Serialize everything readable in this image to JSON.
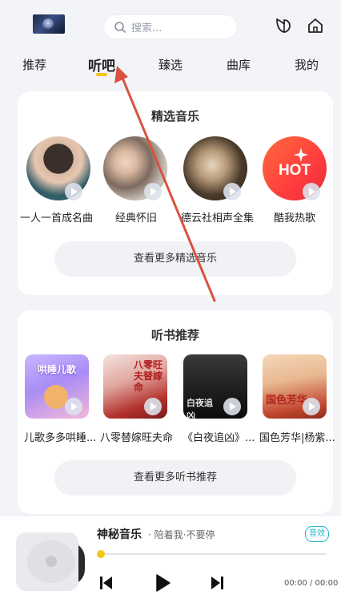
{
  "header": {
    "search_placeholder": "搜索...",
    "icons": [
      "profile-avatar",
      "search-icon",
      "leaf-icon",
      "home-icon"
    ]
  },
  "tabs": [
    {
      "label": "推荐",
      "active": false
    },
    {
      "label": "听吧",
      "active": true
    },
    {
      "label": "臻选",
      "active": false
    },
    {
      "label": "曲库",
      "active": false
    },
    {
      "label": "我的",
      "active": false
    }
  ],
  "featured_music": {
    "title": "精选音乐",
    "items": [
      {
        "label": "一人一首成名曲"
      },
      {
        "label": "经典怀旧"
      },
      {
        "label": "德云社相声全集"
      },
      {
        "label": "酷我热歌",
        "thumb_text": "HOT"
      }
    ],
    "more_label": "查看更多精选音乐"
  },
  "audiobooks": {
    "title": "听书推荐",
    "items": [
      {
        "label": "儿歌多多哄睡...",
        "thumb_text": "哄睡儿歌"
      },
      {
        "label": "八零替嫁旺夫命",
        "thumb_text": "八零旺夫替嫁命"
      },
      {
        "label": "《白夜追凶》...",
        "thumb_text": "白夜追凶"
      },
      {
        "label": "国色芳华|杨紫...",
        "thumb_text": "国色芳华"
      }
    ],
    "more_label": "查看更多听书推荐"
  },
  "player": {
    "song": "神秘音乐",
    "artist": "· 陪着我·不要停",
    "badge": "音效",
    "time": "00:00 / 00:00",
    "progress": 0
  },
  "colors": {
    "accent": "#f5c518",
    "badge": "#22b8c8",
    "annotation_arrow": "#d9533f"
  }
}
